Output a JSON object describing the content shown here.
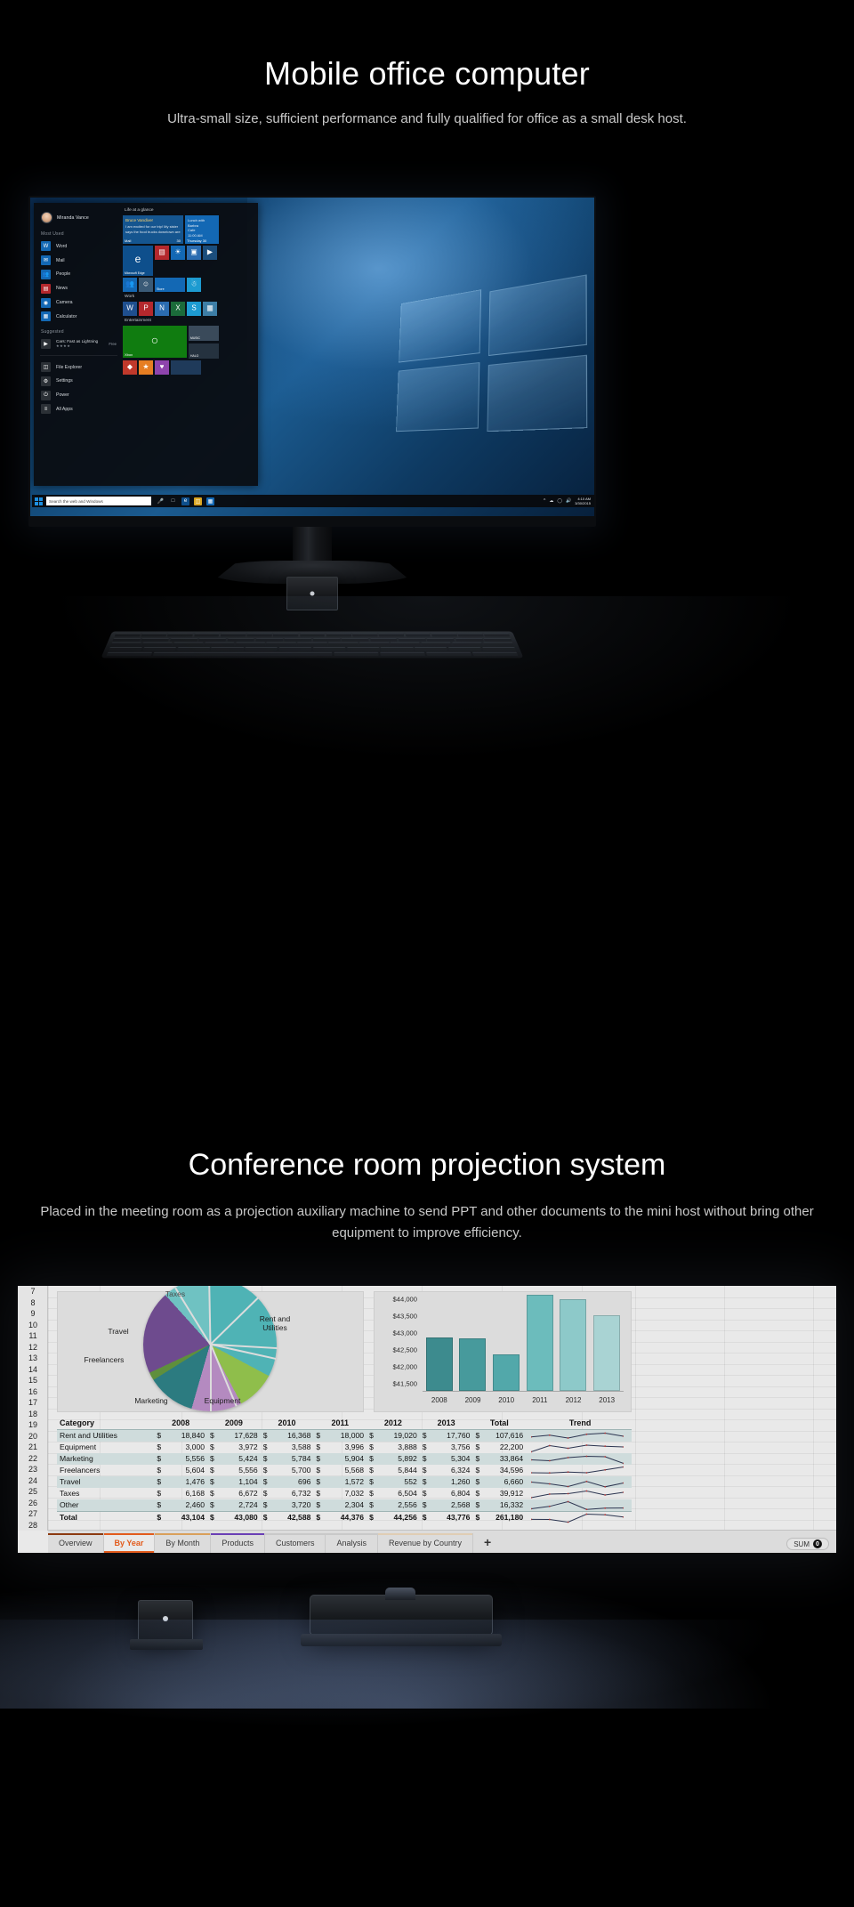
{
  "section1": {
    "title": "Mobile office computer",
    "subtitle": "Ultra-small size, sufficient performance and fully qualified for office as a small desk host.",
    "start_menu": {
      "user_name": "Miranda Vance",
      "most_used_header": "Most Used",
      "most_used": [
        {
          "label": "Word",
          "icon": "word-icon",
          "color": "#1368b4",
          "glyph": "W"
        },
        {
          "label": "Mail",
          "icon": "mail-icon",
          "color": "#1368b4",
          "glyph": "✉"
        },
        {
          "label": "People",
          "icon": "people-icon",
          "color": "#1368b4",
          "glyph": "&"
        },
        {
          "label": "News",
          "icon": "news-icon",
          "color": "#b4282d",
          "glyph": "▤"
        },
        {
          "label": "Camera",
          "icon": "camera-icon",
          "color": "#1368b4",
          "glyph": "◉"
        },
        {
          "label": "Calculator",
          "icon": "calculator-icon",
          "color": "#1368b4",
          "glyph": "☰"
        }
      ],
      "suggested_header": "Suggested",
      "suggested": {
        "title": "Cars: Fast as Lightning",
        "stars": "★★★★",
        "price": "Free"
      },
      "bottom_items": [
        {
          "label": "File Explorer",
          "icon": "folder-icon",
          "glyph": "☰"
        },
        {
          "label": "Settings",
          "icon": "gear-icon",
          "glyph": "⚙"
        },
        {
          "label": "Power",
          "icon": "power-icon",
          "glyph": "⏻"
        },
        {
          "label": "All Apps",
          "icon": "list-icon",
          "glyph": "≡"
        }
      ],
      "tile_groups": [
        {
          "header": "Life at a glance"
        },
        {
          "header": "Work"
        },
        {
          "header": "Entertainment"
        }
      ],
      "tiles": {
        "mail_from": "Bruce Vandiver",
        "mail_body": "I am excited for our trip! My sister says the food trucks downtown are",
        "mail_label": "Mail",
        "mail_badge": "30",
        "cal_title": "Lunch with Barbra",
        "cal_place": "Cafe",
        "cal_time": "11:00 AM",
        "cal_day": "Thursday 30",
        "edge_label": "Microsoft Edge",
        "store_label": "Store",
        "xbox_label": "Xbox",
        "halo_label": "HALO",
        "frozen_label": "",
        "music_label": "MUSIC"
      }
    },
    "taskbar": {
      "search_placeholder": "Search the web and Windows",
      "clock_time": "4:10 AM",
      "clock_date": "3/30/2015"
    }
  },
  "section2": {
    "title": "Conference room projection system",
    "subtitle": "Placed in the meeting room as a projection auxiliary machine to  send PPT and other documents to the mini host without bring other equipment to improve efficiency."
  },
  "excel": {
    "row_numbers": [
      "7",
      "8",
      "9",
      "10",
      "11",
      "12",
      "13",
      "14",
      "15",
      "16",
      "17",
      "18",
      "19",
      "20",
      "21",
      "22",
      "23",
      "24",
      "25",
      "26",
      "27",
      "28"
    ],
    "sheet_tabs": [
      {
        "label": "Overview",
        "active": false,
        "color": "#8c3a10"
      },
      {
        "label": "By Year",
        "active": true,
        "color": "#e25b1c"
      },
      {
        "label": "By Month",
        "active": false,
        "color": "#d9a05b"
      },
      {
        "label": "Products",
        "active": false,
        "color": "#6a3fb5"
      },
      {
        "label": "Customers",
        "active": false,
        "color": "#c9c9c9"
      },
      {
        "label": "Analysis",
        "active": false,
        "color": "#c9c9c9"
      },
      {
        "label": "Revenue by Country",
        "active": false,
        "color": "#e0cdb4"
      }
    ],
    "add_sheet_label": "+",
    "status": {
      "sum_label": "SUM",
      "sum_value": "0"
    }
  },
  "chart_data": [
    {
      "type": "pie",
      "title": "",
      "labels": [
        "Rent and Utilities",
        "Equipment",
        "Marketing",
        "Freelancers",
        "Travel",
        "Taxes",
        "Other"
      ],
      "values": [
        107616,
        22200,
        33864,
        34596,
        6660,
        39912,
        16332
      ],
      "colors": [
        "#4fb3b5",
        "#8fbe4b",
        "#b48ac0",
        "#2c7b80",
        "#5f8f3c",
        "#6e4b8e",
        "#6fc2c2"
      ],
      "visible_labels": [
        "Rent and Utilities",
        "Equipment",
        "Marketing",
        "Freelancers",
        "Travel",
        "Taxes"
      ],
      "legend": "none"
    },
    {
      "type": "bar",
      "title": "",
      "categories": [
        "2008",
        "2009",
        "2010",
        "2011",
        "2012",
        "2013"
      ],
      "values": [
        43104,
        43080,
        42588,
        44376,
        44256,
        43776
      ],
      "ylim": [
        41500,
        44250
      ],
      "yticks": [
        "$41,500",
        "$42,000",
        "$42,500",
        "$43,000",
        "$43,500",
        "$44,000"
      ],
      "colors": [
        "#3d8b8e",
        "#479a9c",
        "#52a8aa",
        "#6cbcbc",
        "#8dc9c9",
        "#a9d3d3"
      ],
      "xlabel": "",
      "ylabel": "",
      "grid": false,
      "legend": "none"
    },
    {
      "type": "table",
      "columns": [
        "Category",
        "2008",
        "2009",
        "2010",
        "2011",
        "2012",
        "2013",
        "Total",
        "Trend"
      ],
      "rows": [
        {
          "category": "Rent and Utilities",
          "values": [
            "18,840",
            "17,628",
            "16,368",
            "18,000",
            "19,020",
            "17,760"
          ],
          "total": "107,616",
          "trend": [
            0.42,
            0.62,
            0.3,
            0.72,
            0.85,
            0.5
          ]
        },
        {
          "category": "Equipment",
          "values": [
            "3,000",
            "3,972",
            "3,588",
            "3,996",
            "3,888",
            "3,756"
          ],
          "total": "22,200",
          "trend": [
            0.05,
            0.75,
            0.45,
            0.8,
            0.68,
            0.6
          ]
        },
        {
          "category": "Marketing",
          "values": [
            "5,556",
            "5,424",
            "5,784",
            "5,904",
            "5,892",
            "5,304"
          ],
          "total": "33,864",
          "trend": [
            0.45,
            0.35,
            0.7,
            0.85,
            0.8,
            0.05
          ]
        },
        {
          "category": "Freelancers",
          "values": [
            "5,604",
            "5,556",
            "5,700",
            "5,568",
            "5,844",
            "6,324"
          ],
          "total": "34,596",
          "trend": [
            0.3,
            0.28,
            0.38,
            0.3,
            0.62,
            0.95
          ]
        },
        {
          "category": "Travel",
          "values": [
            "1,476",
            "1,104",
            "696",
            "1,572",
            "552",
            "1,260"
          ],
          "total": "6,660",
          "trend": [
            0.55,
            0.35,
            0.05,
            0.62,
            0.02,
            0.45
          ]
        },
        {
          "category": "Taxes",
          "values": [
            "6,168",
            "6,672",
            "6,732",
            "7,032",
            "6,504",
            "6,804"
          ],
          "total": "39,912",
          "trend": [
            0.1,
            0.5,
            0.55,
            0.85,
            0.4,
            0.7
          ]
        },
        {
          "category": "Other",
          "values": [
            "2,460",
            "2,724",
            "3,720",
            "2,304",
            "2,556",
            "2,568"
          ],
          "total": "16,332",
          "trend": [
            0.15,
            0.42,
            0.95,
            0.08,
            0.22,
            0.24
          ]
        },
        {
          "category": "Total",
          "values": [
            "43,104",
            "43,080",
            "42,588",
            "44,376",
            "44,256",
            "43,776"
          ],
          "total": "261,180",
          "trend": [
            0.36,
            0.35,
            0.05,
            0.95,
            0.88,
            0.62
          ]
        }
      ],
      "currency_symbol": "$"
    }
  ]
}
